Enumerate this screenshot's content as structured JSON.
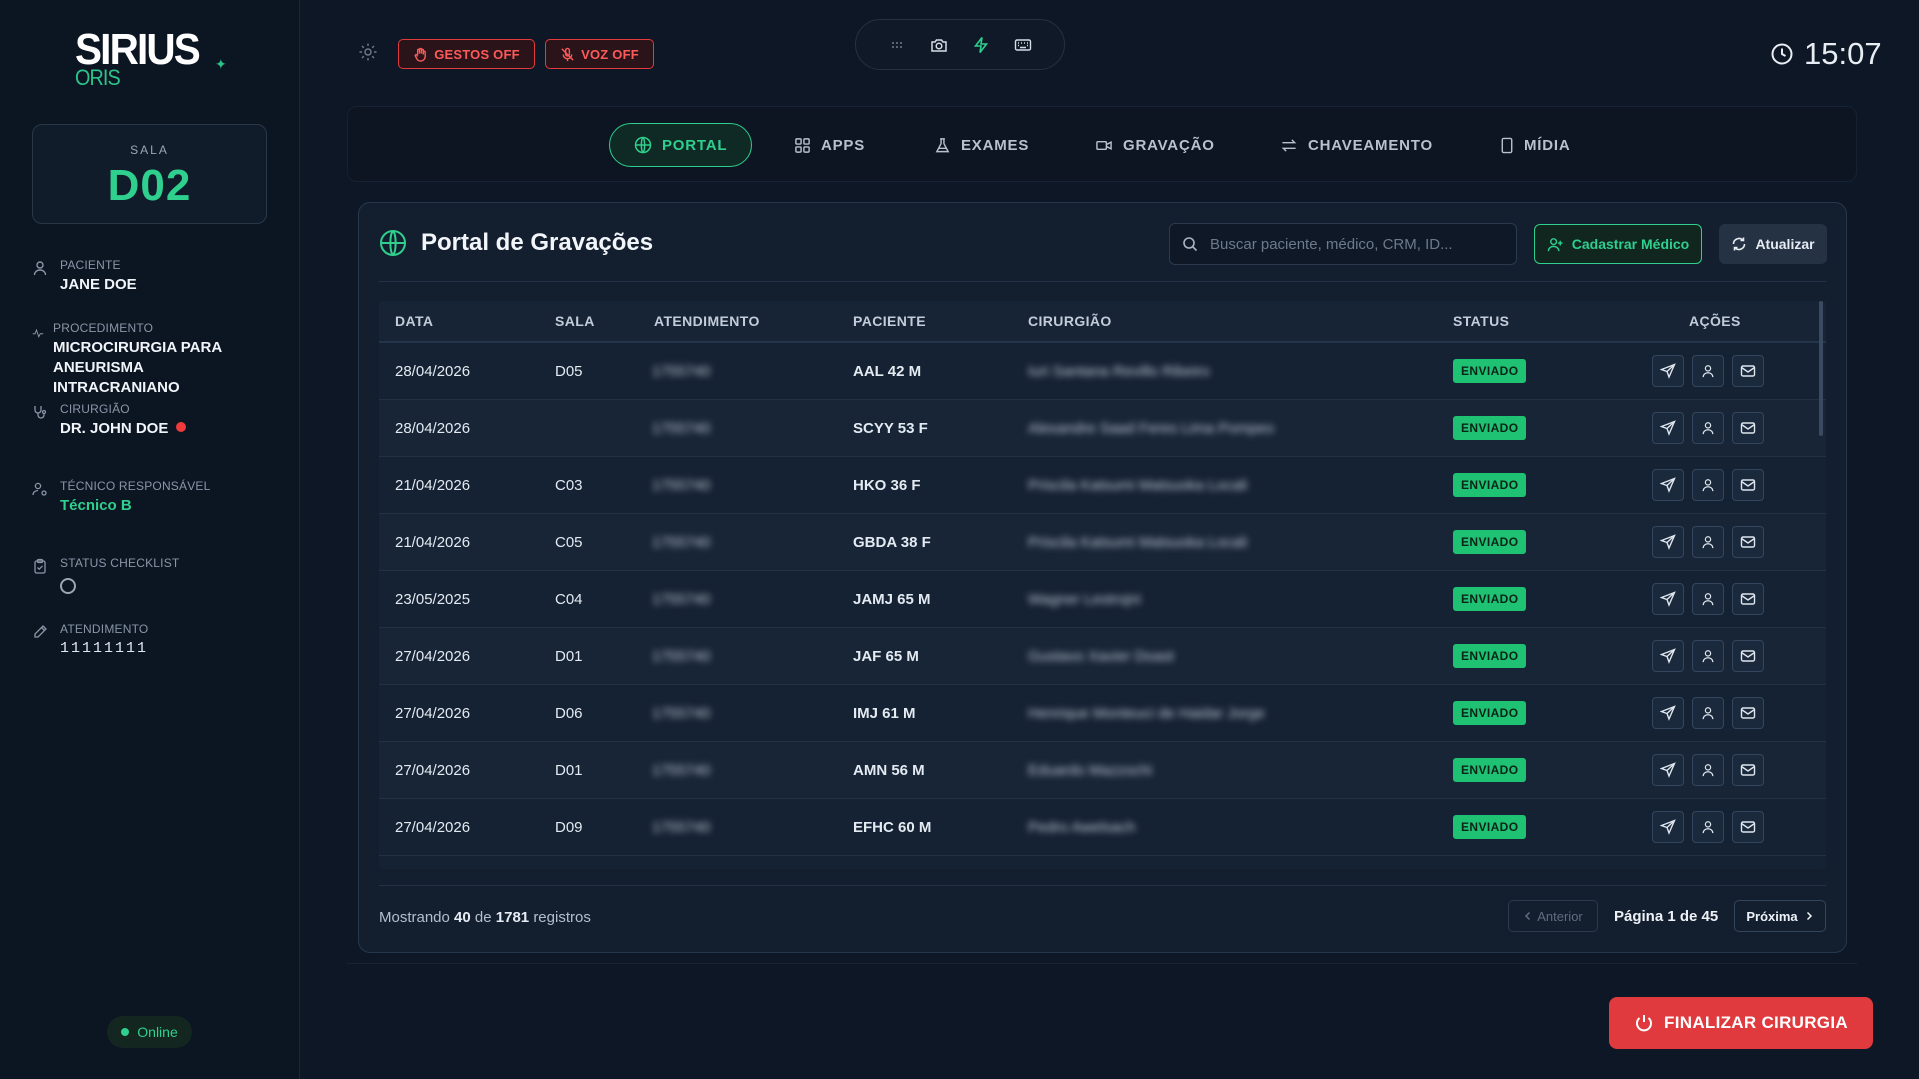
{
  "brand": {
    "name": "SIRIUS",
    "sub": "ORIS"
  },
  "room": {
    "label": "SALA",
    "value": "D02"
  },
  "patient": {
    "label": "PACIENTE",
    "value": "JANE DOE"
  },
  "procedure": {
    "label": "PROCEDIMENTO",
    "value": "MICROCIRURGIA PARA ANEURISMA INTRACRANIANO"
  },
  "surgeon": {
    "label": "CIRURGIÃO",
    "value": "DR. JOHN DOE"
  },
  "technician": {
    "label": "TÉCNICO RESPONSÁVEL",
    "value": "Técnico B"
  },
  "checklist": {
    "label": "STATUS CHECKLIST"
  },
  "attendance": {
    "label": "ATENDIMENTO",
    "value": "11111111"
  },
  "status_online": "Online",
  "toggles": {
    "gestos": "GESTOS OFF",
    "voz": "VOZ OFF"
  },
  "toolbar_icons": [
    "grid-icon",
    "camera-icon",
    "lightning-icon",
    "keyboard-icon"
  ],
  "clock": "15:07",
  "tabs": [
    {
      "label": "PORTAL",
      "icon": "globe-icon",
      "active": true
    },
    {
      "label": "APPS",
      "icon": "apps-icon"
    },
    {
      "label": "EXAMES",
      "icon": "flask-icon"
    },
    {
      "label": "GRAVAÇÃO",
      "icon": "video-icon"
    },
    {
      "label": "CHAVEAMENTO",
      "icon": "swap-icon"
    },
    {
      "label": "MÍDIA",
      "icon": "phone-icon"
    }
  ],
  "portal": {
    "title": "Portal de Gravações",
    "search_placeholder": "Buscar paciente, médico, CRM, ID...",
    "register_label": "Cadastrar Médico",
    "refresh_label": "Atualizar"
  },
  "table": {
    "headers": [
      "DATA",
      "SALA",
      "ATENDIMENTO",
      "PACIENTE",
      "CIRURGIÃO",
      "STATUS",
      "AÇÕES"
    ],
    "rows": [
      {
        "data": "28/04/2026",
        "sala": "D05",
        "atendimento": "1755740",
        "paciente": "AAL 42 M",
        "cirurgiao": "Iuri Santana Revillo Ribeiro",
        "status": "ENVIADO"
      },
      {
        "data": "28/04/2026",
        "sala": "",
        "atendimento": "1755740",
        "paciente": "SCYY 53 F",
        "cirurgiao": "Alexandre Saad Feres Lima Pompeo",
        "status": "ENVIADO"
      },
      {
        "data": "21/04/2026",
        "sala": "C03",
        "atendimento": "1755740",
        "paciente": "HKO 36 F",
        "cirurgiao": "Priscila Katsumi Matsuoka Locali",
        "status": "ENVIADO"
      },
      {
        "data": "21/04/2026",
        "sala": "C05",
        "atendimento": "1755740",
        "paciente": "GBDA 38 F",
        "cirurgiao": "Priscila Katsumi Matsuoka Locali",
        "status": "ENVIADO"
      },
      {
        "data": "23/05/2025",
        "sala": "C04",
        "atendimento": "1755740",
        "paciente": "JAMJ 65 M",
        "cirurgiao": "Wagner Lestrojni",
        "status": "ENVIADO"
      },
      {
        "data": "27/04/2026",
        "sala": "D01",
        "atendimento": "1755740",
        "paciente": "JAF 65 M",
        "cirurgiao": "Gustavo Xavier Doast",
        "status": "ENVIADO"
      },
      {
        "data": "27/04/2026",
        "sala": "D06",
        "atendimento": "1755740",
        "paciente": "IMJ 61 M",
        "cirurgiao": "Henrique Monteuci de Haidar Jorge",
        "status": "ENVIADO"
      },
      {
        "data": "27/04/2026",
        "sala": "D01",
        "atendimento": "1755740",
        "paciente": "AMN 56 M",
        "cirurgiao": "Eduardo Mazzochi",
        "status": "ENVIADO"
      },
      {
        "data": "27/04/2026",
        "sala": "D09",
        "atendimento": "1755740",
        "paciente": "EFHC 60 M",
        "cirurgiao": "Pedro Awelsach",
        "status": "ENVIADO"
      }
    ]
  },
  "footer": {
    "showing_prefix": "Mostrando",
    "shown": "40",
    "of": "de",
    "total": "1781",
    "suffix": "registros",
    "prev": "Anterior",
    "page_info": "Página 1 de 45",
    "next": "Próxima"
  },
  "finish_label": "FINALIZAR CIRURGIA",
  "colors": {
    "accent": "#2fcf8e",
    "danger": "#e03a3e",
    "background": "#0e1725"
  }
}
